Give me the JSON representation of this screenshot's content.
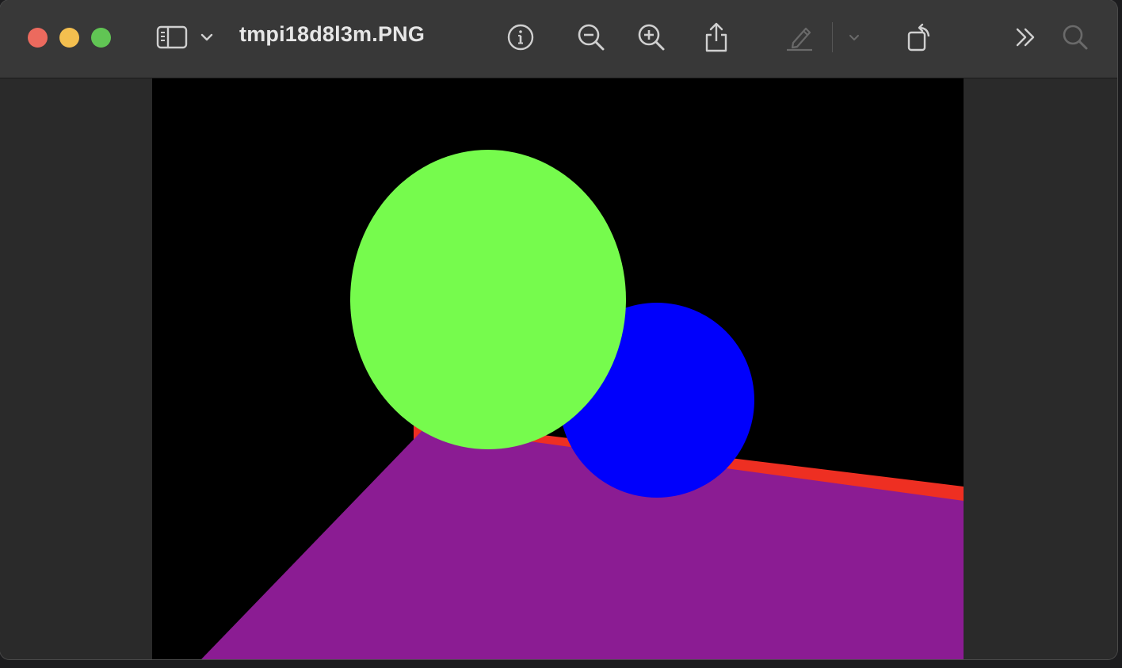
{
  "window": {
    "title": "tmpi18d8l3m.PNG"
  },
  "toolbar": {
    "items": [
      {
        "icon": "sidebar-toggle-icon"
      },
      {
        "icon": "chevron-down-icon"
      },
      {
        "icon": "info-icon"
      },
      {
        "icon": "zoom-out-icon"
      },
      {
        "icon": "zoom-in-icon"
      },
      {
        "icon": "share-icon"
      },
      {
        "icon": "markup-pen-icon"
      },
      {
        "icon": "markup-chevron-down-icon"
      },
      {
        "icon": "rotate-icon"
      },
      {
        "icon": "more-chevrons-icon"
      },
      {
        "icon": "search-icon"
      }
    ]
  },
  "image": {
    "background_color": "#000000",
    "shapes": [
      {
        "name": "purple-plane",
        "color": "#8b1c93"
      },
      {
        "name": "red-stripe",
        "color": "#ee2f22"
      },
      {
        "name": "green-sphere",
        "color": "#76fb4d"
      },
      {
        "name": "blue-sphere",
        "color": "#0000fc"
      }
    ]
  },
  "colors": {
    "toolbar_bg": "#383838",
    "window_bg": "#2a2a2a",
    "close": "#ec6a5e",
    "minimize": "#f4bf4f",
    "maximize": "#61c554",
    "icon": "#d0d0d0",
    "icon_disabled": "#6a6a6a"
  }
}
